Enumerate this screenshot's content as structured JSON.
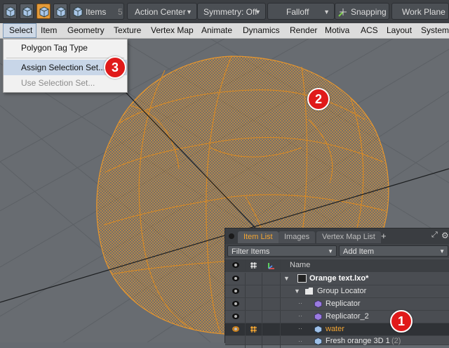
{
  "toolbar": {
    "items_label": "Items",
    "items_count": "5",
    "action_center": "Action Center",
    "symmetry": "Symmetry: Off",
    "falloff": "Falloff",
    "snapping": "Snapping",
    "work_plane": "Work Plane"
  },
  "menubar": [
    "Select",
    "Item",
    "Geometry",
    "Texture",
    "Vertex Map",
    "Animate",
    "Dynamics",
    "Render",
    "Motiva",
    "ACS",
    "Layout",
    "System"
  ],
  "dropdown": {
    "items": [
      "Polygon Tag Type",
      "Assign Selection Set...",
      "Use Selection Set..."
    ]
  },
  "callouts": [
    "1",
    "2",
    "3"
  ],
  "panel": {
    "tabs": [
      "Item List",
      "Images",
      "Vertex Map List"
    ],
    "tab_add": "+",
    "filter_label": "Filter Items",
    "add_item_label": "Add Item",
    "column_name": "Name",
    "rows": [
      {
        "label": "Orange text.lxo*",
        "bold": true
      },
      {
        "label": "Group Locator"
      },
      {
        "label": "Replicator"
      },
      {
        "label": "Replicator_2"
      },
      {
        "label": "water",
        "selected": true
      },
      {
        "label": "Fresh orange 3D 1",
        "suffix": "(2)"
      }
    ]
  },
  "colors": {
    "accent_orange": "#f2a533",
    "wire_orange": "#e6962e",
    "callout_red": "#e01a1a"
  }
}
